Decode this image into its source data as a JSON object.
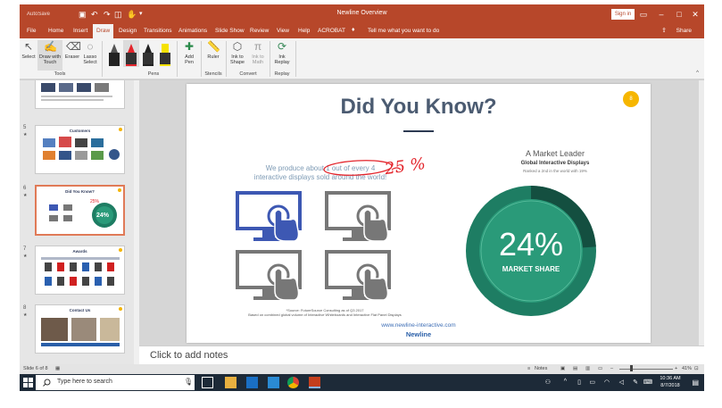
{
  "window": {
    "title": "Newline Overview",
    "signin_label": "Sign in",
    "autosave_label": "AutoSave"
  },
  "colors": {
    "accent": "#b7472a",
    "slide_title": "#4b5b71",
    "donut_outer": "#1e7d63",
    "donut_inner": "#2a9a79",
    "monitor_active": "#3d58b3",
    "monitor_inactive": "#777777",
    "ink_red": "#e3242b"
  },
  "tabs": [
    {
      "label": "File"
    },
    {
      "label": "Home"
    },
    {
      "label": "Insert"
    },
    {
      "label": "Draw"
    },
    {
      "label": "Design"
    },
    {
      "label": "Transitions"
    },
    {
      "label": "Animations"
    },
    {
      "label": "Slide Show"
    },
    {
      "label": "Review"
    },
    {
      "label": "View"
    },
    {
      "label": "Help"
    },
    {
      "label": "ACROBAT"
    }
  ],
  "tell_me": "Tell me what you want to do",
  "share_label": "Share",
  "ribbon": {
    "tools": {
      "select": "Select",
      "draw_touch": "Draw with Touch",
      "eraser": "Eraser",
      "lasso": "Lasso Select",
      "group": "Tools"
    },
    "pens": {
      "add_pen": "Add Pen",
      "group": "Pens"
    },
    "stencils": {
      "ruler": "Ruler",
      "group": "Stencils"
    },
    "convert": {
      "ink_to_shape": "Ink to Shape",
      "ink_to_math": "Ink to Math",
      "group": "Convert"
    },
    "replay": {
      "ink_replay": "Ink Replay",
      "group": "Replay"
    }
  },
  "thumbnails": [
    {
      "number": "",
      "title": ""
    },
    {
      "number": "5",
      "title": "Customers"
    },
    {
      "number": "6",
      "title": "Did You Know?",
      "selected": true,
      "share": "24%"
    },
    {
      "number": "7",
      "title": "Awards"
    },
    {
      "number": "8",
      "title": "Contact Us"
    }
  ],
  "slide": {
    "title": "Did You Know?",
    "badge": "8",
    "claim_line1": "We produce about 1 out of every 4",
    "claim_line2": "interactive displays sold around the world!",
    "ink_note": "25 %",
    "leader_title": "A Market Leader",
    "leader_subtitle": "Global Interactive Displays",
    "leader_rank": "Ranked a 2nd in the world with 19%",
    "share_value": "24%",
    "share_label": "MARKET SHARE",
    "market_share_fraction": 0.24,
    "source_line1": "*Source: FutureSource Consulting as of Q3 2017",
    "source_line2": "Based on combined global volume of Interactive Whiteboards and Interactive Flat Panel Displays",
    "url": "www.newline-interactive.com",
    "logo": "Newline"
  },
  "notes_placeholder": "Click to add notes",
  "status": {
    "slide_counter": "Slide 6 of 8",
    "notes_label": "Notes",
    "zoom": "41%"
  },
  "taskbar": {
    "search_placeholder": "Type here to search",
    "time": "10:36 AM",
    "date": "8/7/2018"
  }
}
